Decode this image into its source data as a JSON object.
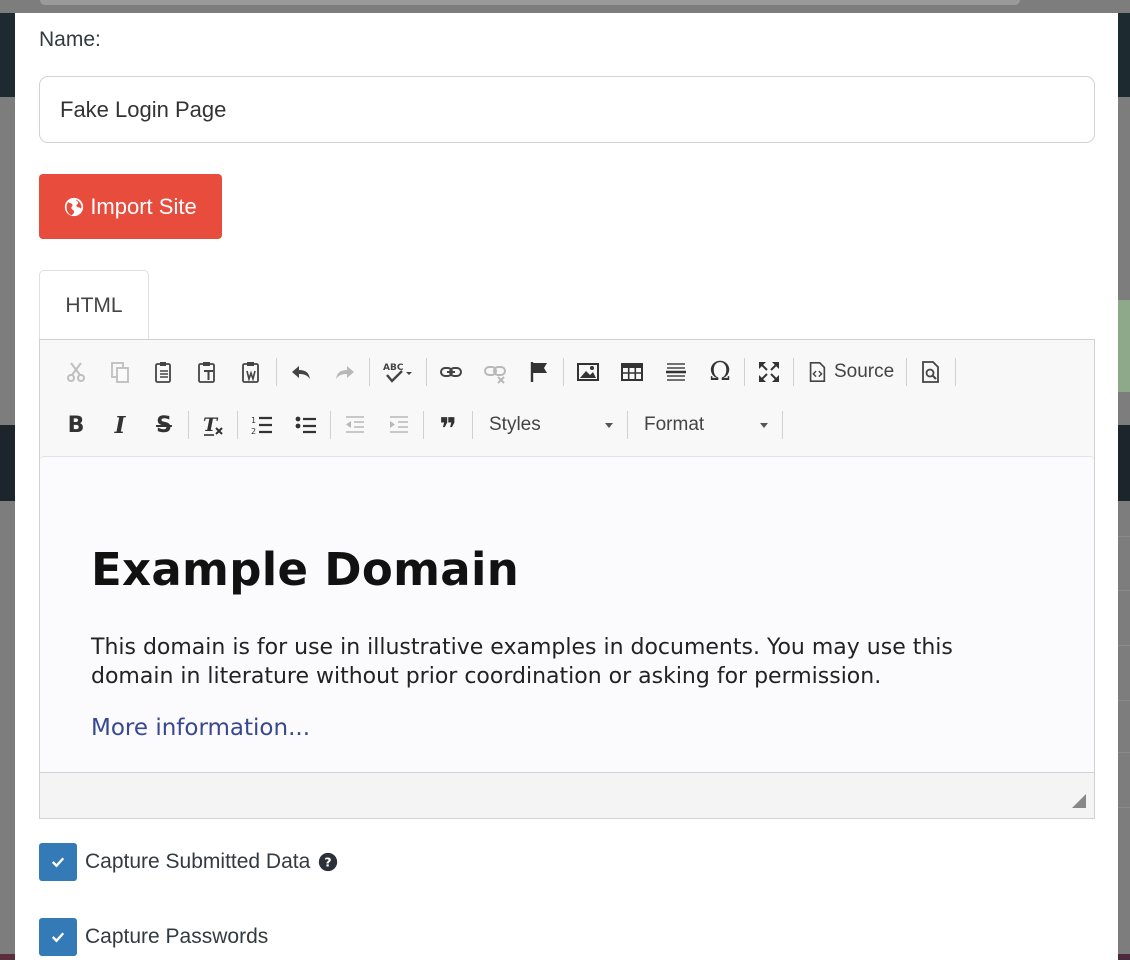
{
  "colors": {
    "import_button": "#e74c3c",
    "checkbox": "#337ab7",
    "link": "#38488f",
    "backdrop": "#7d7d7d"
  },
  "form": {
    "name_label": "Name:",
    "name_value": "Fake Login Page",
    "import_button_label": "Import Site",
    "import_button_icon": "globe-icon"
  },
  "tabs": [
    {
      "label": "HTML",
      "active": true
    }
  ],
  "toolbar": {
    "row1": [
      {
        "name": "cut-icon",
        "disabled": true
      },
      {
        "name": "copy-icon",
        "disabled": true
      },
      {
        "name": "paste-icon"
      },
      {
        "name": "paste-text-icon"
      },
      {
        "name": "paste-word-icon"
      },
      {
        "name": "undo-icon"
      },
      {
        "name": "redo-icon",
        "disabled": true
      },
      {
        "name": "spellcheck-icon"
      },
      {
        "name": "link-icon"
      },
      {
        "name": "unlink-icon",
        "disabled": true
      },
      {
        "name": "anchor-flag-icon"
      },
      {
        "name": "image-icon"
      },
      {
        "name": "table-icon"
      },
      {
        "name": "horizontal-line-icon"
      },
      {
        "name": "special-char-icon"
      },
      {
        "name": "maximize-icon"
      },
      {
        "name": "source-icon"
      },
      {
        "name": "preview-icon"
      }
    ],
    "source_label": "Source",
    "special_char_glyph": "Ω",
    "row2": [
      {
        "name": "bold-icon",
        "glyph": "B"
      },
      {
        "name": "italic-icon",
        "glyph": "I"
      },
      {
        "name": "strikethrough-icon",
        "glyph": "S"
      },
      {
        "name": "remove-format-icon",
        "glyph": "Tx"
      },
      {
        "name": "numbered-list-icon"
      },
      {
        "name": "bulleted-list-icon"
      },
      {
        "name": "outdent-icon",
        "disabled": true
      },
      {
        "name": "indent-icon",
        "disabled": true
      },
      {
        "name": "blockquote-icon",
        "glyph": "❞"
      }
    ],
    "styles_label": "Styles",
    "format_label": "Format"
  },
  "editor_content": {
    "heading": "Example Domain",
    "paragraph_line1": "This domain is for use in illustrative examples in documents. You may use this",
    "paragraph_line2": "domain in literature without prior coordination or asking for permission.",
    "link_text": "More information..."
  },
  "options": {
    "capture_submitted_label": "Capture Submitted Data",
    "capture_submitted_checked": true,
    "capture_passwords_label": "Capture Passwords",
    "capture_passwords_checked": true
  }
}
